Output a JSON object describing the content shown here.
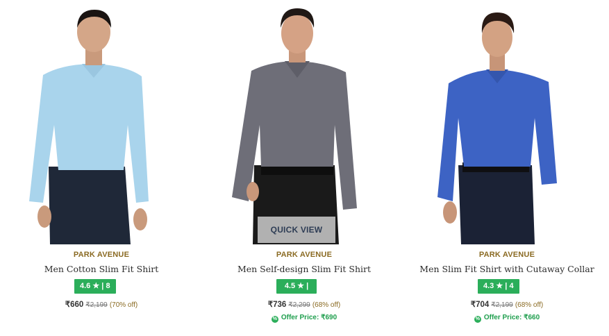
{
  "products": [
    {
      "brand": "PARK AVENUE",
      "name": "Men Cotton Slim Fit Shirt",
      "rating": "4.6",
      "reviews": "8",
      "price": "₹660",
      "mrp": "₹2,199",
      "discount": "(70% off)",
      "offer": "",
      "shirt_color": "#a9d4ec",
      "pants_color": "#1f2838"
    },
    {
      "brand": "PARK AVENUE",
      "name": "Men Self-design Slim Fit Shirt",
      "rating": "4.5",
      "reviews": "2",
      "price": "₹736",
      "mrp": "₹2,299",
      "discount": "(68% off)",
      "offer": "Offer Price: ₹690",
      "quick_view": "QUICK VIEW",
      "shirt_color": "#6e6e78",
      "pants_color": "#1a1a1a"
    },
    {
      "brand": "PARK AVENUE",
      "name": "Men Slim Fit Shirt with Cutaway Collar",
      "rating": "4.3",
      "reviews": "4",
      "price": "₹704",
      "mrp": "₹2,199",
      "discount": "(68% off)",
      "offer": "Offer Price: ₹660",
      "shirt_color": "#3d63c4",
      "pants_color": "#1b2235"
    }
  ],
  "icons": {
    "star": "star-icon",
    "offer": "offer-tag-icon"
  },
  "colors": {
    "rating_bg": "#2bae5a",
    "brand": "#8a6a22",
    "offer": "#1e9e4d"
  }
}
